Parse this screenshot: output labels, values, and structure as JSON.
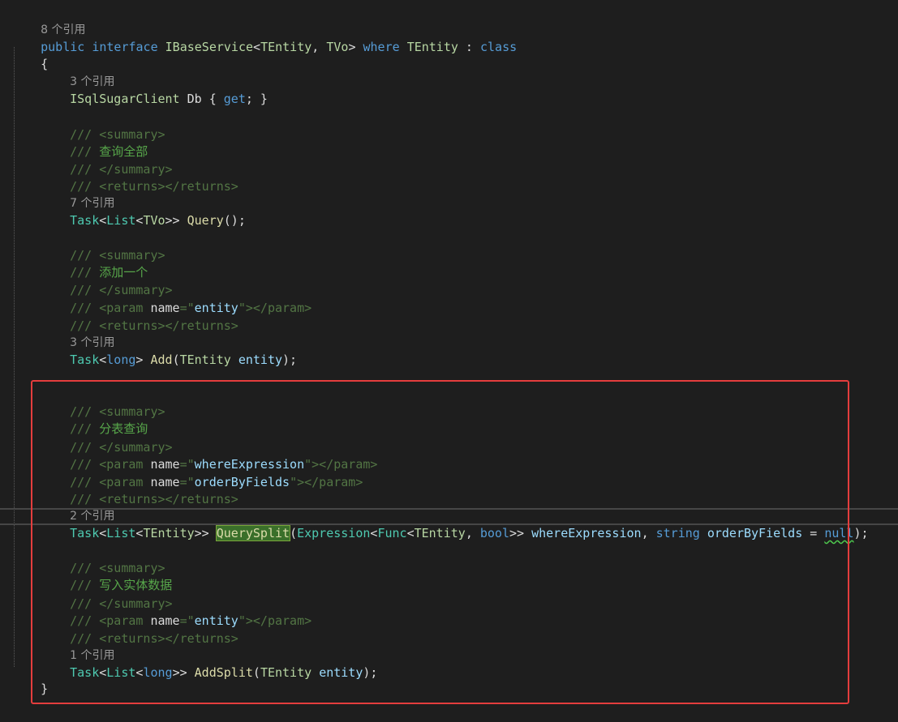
{
  "colors": {
    "background": "#1e1e1e",
    "highlight_box": "#e43d3d",
    "comment": "#57a64a",
    "keyword": "#569cd6",
    "type": "#4ec9b0"
  },
  "refs": {
    "r1": "8 个引用",
    "r2": "3 个引用",
    "r3": "7 个引用",
    "r4": "3 个引用",
    "r5": "2 个引用",
    "r6": "1 个引用"
  },
  "code": {
    "decl_kw1": "public",
    "decl_kw2": "interface",
    "decl_name": "IBaseService",
    "decl_lt": "<",
    "decl_t1": "TEntity",
    "decl_comma": ", ",
    "decl_t2": "TVo",
    "decl_gt": ">",
    "decl_where": "where",
    "decl_t3": "TEntity",
    "decl_colon": " : ",
    "decl_class": "class",
    "open_brace": "{",
    "close_brace": "}",
    "db_type": "ISqlSugarClient",
    "db_name": "Db",
    "db_open": "{ ",
    "db_get": "get",
    "db_close": "; }",
    "doc_prefix": "/// ",
    "sum_open": "<summary>",
    "sum_close": "</summary>",
    "ret": "<returns></returns>",
    "param_open": "<param ",
    "param_name_attr": "name",
    "param_eq": "=\"",
    "param_quote": "\"",
    "param_close": "></param>",
    "doc_query_all": "查询全部",
    "doc_add_one": "添加一个",
    "doc_split_query": "分表查询",
    "doc_write_data": "写入实体数据",
    "p_entity": "entity",
    "p_where": "whereExpression",
    "p_order": "orderByFields",
    "task": "Task",
    "list": "List",
    "tvo": "TVo",
    "tentity": "TEntity",
    "long": "long",
    "bool": "bool",
    "string": "string",
    "null": "null",
    "expression": "Expression",
    "func": "Func",
    "m_query": "Query",
    "m_add": "Add",
    "m_query_split": "QuerySplit",
    "m_add_split": "AddSplit",
    "lt": "<",
    "gt": ">",
    "gtgt": ">>",
    "gtgtsp": ">> ",
    "paren_empty": "();",
    "lparen": "(",
    "rparen_semi": ");",
    "space": " ",
    "comma_sp": ", ",
    "eq_sp": " = "
  }
}
